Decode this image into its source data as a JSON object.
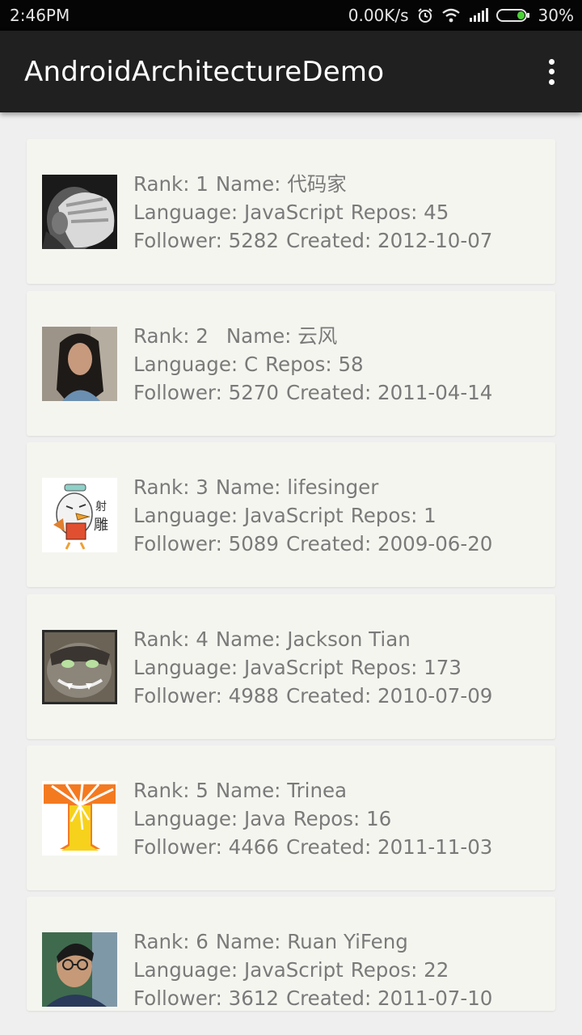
{
  "status_bar": {
    "time": "2:46PM",
    "net_speed": "0.00K/s",
    "battery": "30%",
    "icons": [
      "alarm-icon",
      "wifi-icon",
      "signal-icon",
      "battery-icon"
    ]
  },
  "app_bar": {
    "title": "AndroidArchitectureDemo",
    "menu_icon": "overflow-menu-icon"
  },
  "colors": {
    "status_bar_bg": "#050505",
    "app_bar_bg": "#202020",
    "page_bg": "#efefef",
    "card_bg": "#f5f5f0",
    "text_gray": "#7a7a7a"
  },
  "labels": {
    "rank": "Rank:",
    "name": "Name:",
    "language": "Language:",
    "repos": "Repos:",
    "follower": "Follower:",
    "created": "Created:"
  },
  "users": [
    {
      "rank": "1",
      "name": "代码家",
      "language": "JavaScript",
      "repos": "45",
      "follower": "5282",
      "created": "2012-10-07",
      "avatar": "grayscale-face-hand-avatar"
    },
    {
      "rank": "2",
      "name": "云风",
      "language": "C",
      "repos": "58",
      "follower": "5270",
      "created": "2011-04-14",
      "avatar": "long-hair-man-avatar"
    },
    {
      "rank": "3",
      "name": "lifesinger",
      "language": "JavaScript",
      "repos": "1",
      "follower": "5089",
      "created": "2009-06-20",
      "avatar": "cartoon-eagle-avatar"
    },
    {
      "rank": "4",
      "name": "Jackson Tian",
      "language": "JavaScript",
      "repos": "173",
      "follower": "4988",
      "created": "2010-07-09",
      "avatar": "raccoon-warrior-avatar"
    },
    {
      "rank": "5",
      "name": "Trinea",
      "language": "Java",
      "repos": "16",
      "follower": "4466",
      "created": "2011-11-03",
      "avatar": "orange-letter-t-avatar"
    },
    {
      "rank": "6",
      "name": "Ruan YiFeng",
      "language": "JavaScript",
      "repos": "22",
      "follower": "3612",
      "created": "2011-07-10",
      "avatar": "man-with-glasses-avatar"
    }
  ]
}
